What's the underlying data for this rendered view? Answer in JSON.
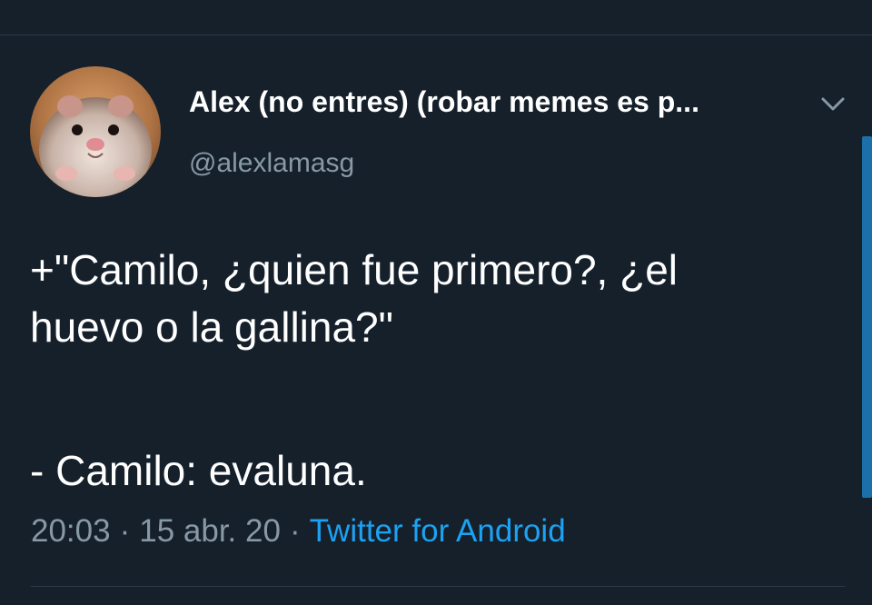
{
  "tweet": {
    "author": {
      "display_name": "Alex (no entres) (robar memes es p...",
      "handle": "@alexlamasg"
    },
    "text": {
      "line1": "+\"Camilo, ¿quien fue primero?, ¿el",
      "line2": "huevo o la gallina?\"",
      "line3": "- Camilo: evaluna."
    },
    "meta": {
      "time": "20:03",
      "separator": "·",
      "date": "15 abr. 20",
      "source": "Twitter for Android"
    }
  },
  "icons": {
    "more_menu": "chevron-down-icon",
    "avatar": "hamster-avatar"
  },
  "colors": {
    "background": "#15202b",
    "text_primary": "#ffffff",
    "text_secondary": "#8899a6",
    "accent": "#1da1f2",
    "scrollbar": "#1c6fa8",
    "divider": "#2c3a48"
  }
}
